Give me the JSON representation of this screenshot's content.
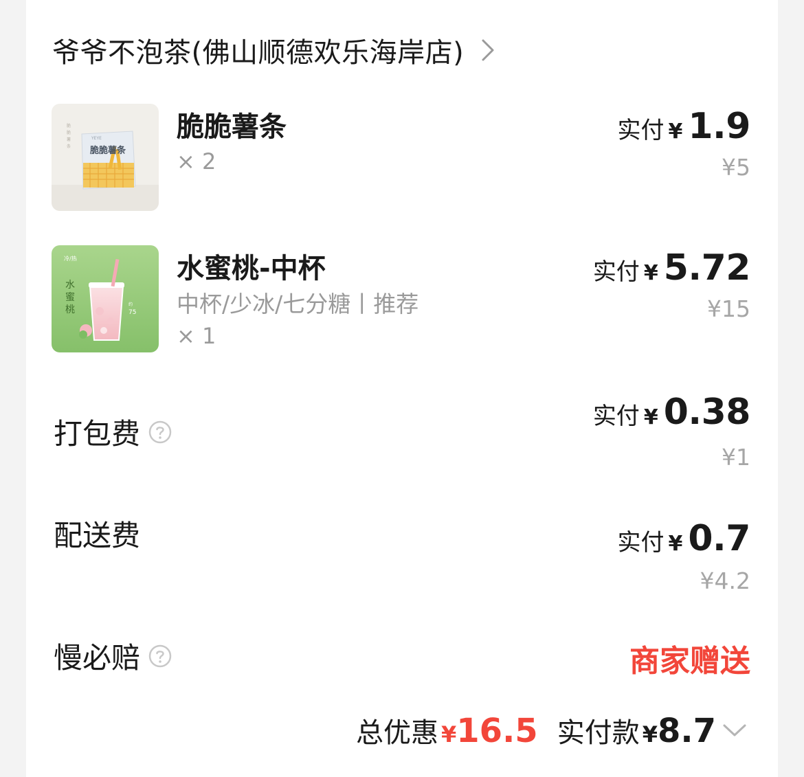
{
  "store": {
    "name": "爷爷不泡茶(佛山顺德欢乐海岸店)"
  },
  "items": [
    {
      "name": "脆脆薯条",
      "qty": "× 2",
      "paid_label": "实付",
      "currency": "¥",
      "paid": "1.9",
      "original": "¥5",
      "package_text": "脆脆薯条"
    },
    {
      "name": "水蜜桃-中杯",
      "spec": "中杯/少冰/七分糖丨推荐",
      "qty": "× 1",
      "paid_label": "实付",
      "currency": "¥",
      "paid": "5.72",
      "original": "¥15",
      "package_text": "水蜜桃"
    }
  ],
  "fees": [
    {
      "name": "打包费",
      "has_help": true,
      "paid_label": "实付",
      "currency": "¥",
      "paid": "0.38",
      "original": "¥1"
    },
    {
      "name": "配送费",
      "has_help": false,
      "paid_label": "实付",
      "currency": "¥",
      "paid": "0.7",
      "original": "¥4.2"
    },
    {
      "name": "慢必赔",
      "has_help": true,
      "status": "商家赠送"
    }
  ],
  "summary": {
    "discount_label": "总优惠",
    "currency": "¥",
    "discount": "16.5",
    "paid_label": "实付款",
    "paid": "8.7"
  },
  "colors": {
    "accent_red": "#f2463a",
    "muted_text": "#9a9a9a",
    "text": "#1a1a1a",
    "background": "#f3f3f3",
    "card": "#ffffff"
  },
  "icons": [
    "chevron-right-icon",
    "help-circle-icon",
    "chevron-down-icon"
  ]
}
